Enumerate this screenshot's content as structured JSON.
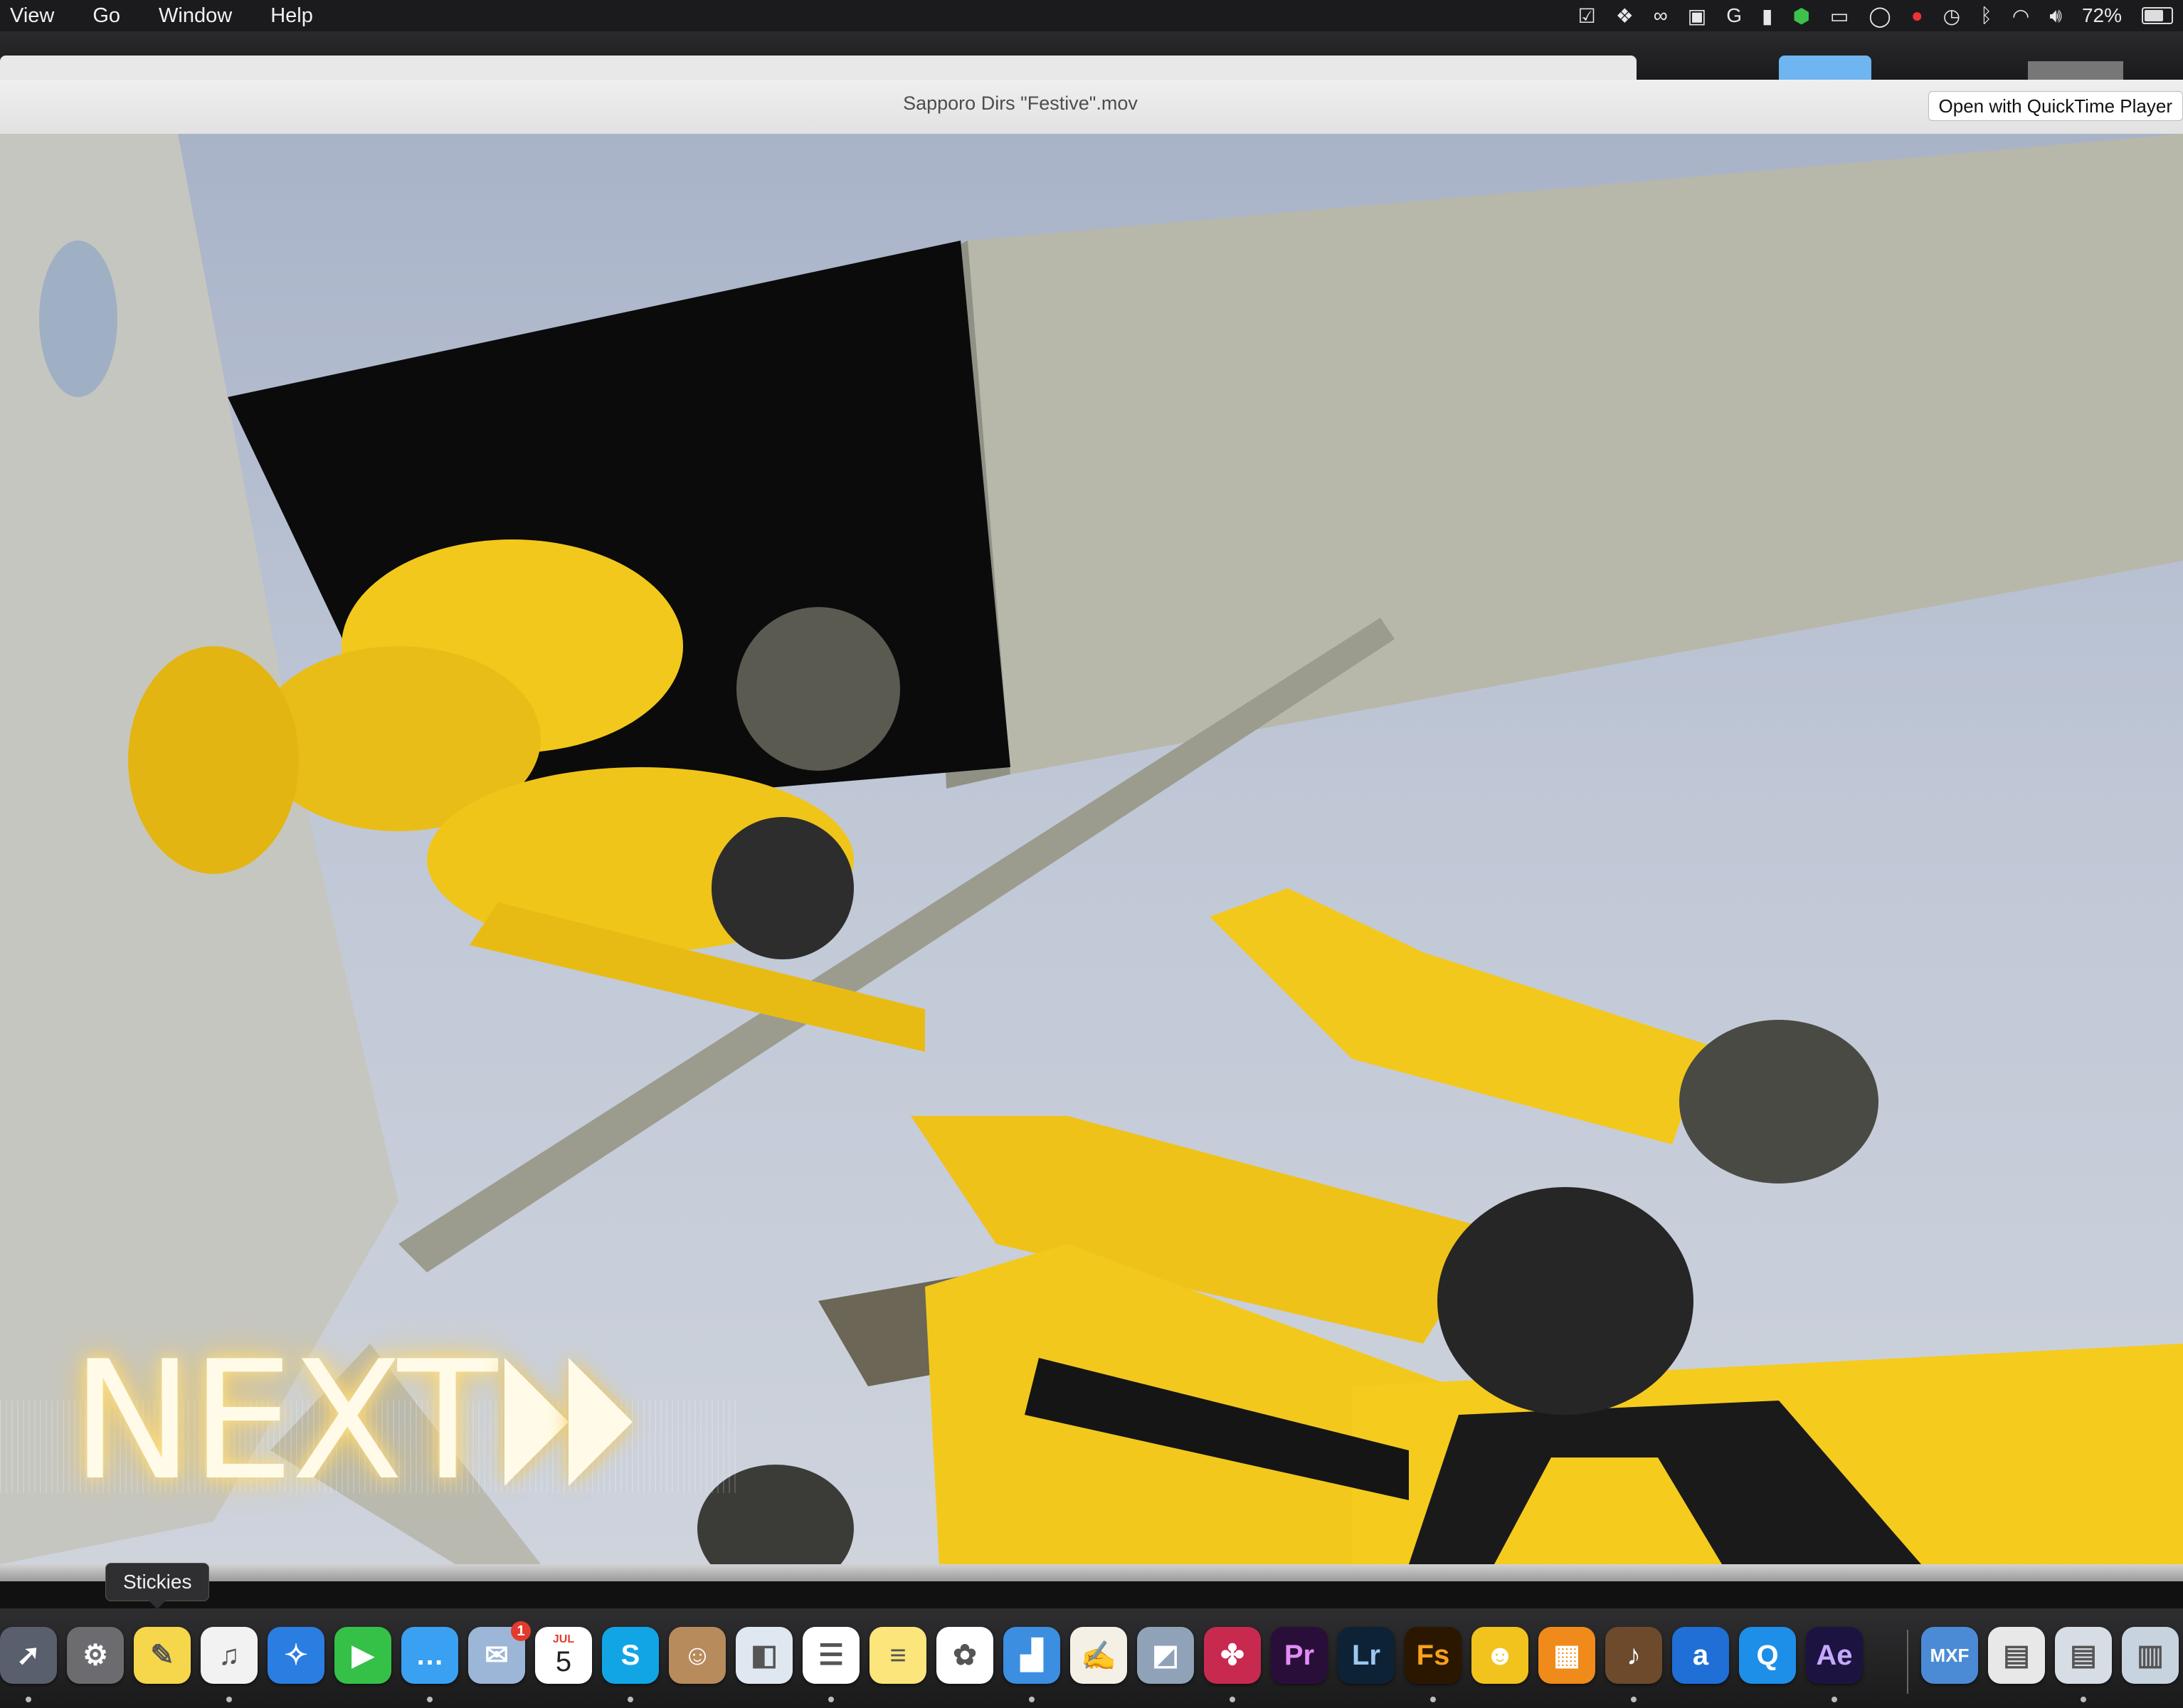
{
  "menubar": {
    "items": [
      "View",
      "Go",
      "Window",
      "Help"
    ],
    "battery_percent": "72%"
  },
  "quicklook": {
    "title": "Sapporo Dirs \"Festive\".mov",
    "open_with_label": "Open with QuickTime Player"
  },
  "video": {
    "overlay_text": "NEXT"
  },
  "tooltip": {
    "label": "Stickies"
  },
  "dock": {
    "items": [
      {
        "name": "launchpad",
        "icon": "rocket-icon",
        "color": "#5a5f6e"
      },
      {
        "name": "system-preferences",
        "icon": "gear-icon",
        "color": "#6c6c70"
      },
      {
        "name": "stickies",
        "icon": "stickies-icon",
        "color": "#f6d64a"
      },
      {
        "name": "itunes",
        "icon": "music-note-icon",
        "color": "#f2f2f2"
      },
      {
        "name": "safari",
        "icon": "compass-icon",
        "color": "#2a7de1"
      },
      {
        "name": "facetime",
        "icon": "video-camera-icon",
        "color": "#35c048"
      },
      {
        "name": "messages",
        "icon": "speech-bubble-icon",
        "color": "#3aa0f2"
      },
      {
        "name": "mail",
        "icon": "stamp-icon",
        "color": "#9cb6d8",
        "badge": "1"
      },
      {
        "name": "calendar",
        "icon": "calendar-icon",
        "color": "#ffffff",
        "month": "JUL",
        "day": "5"
      },
      {
        "name": "skype",
        "icon": "skype-icon",
        "color": "#12a5e6"
      },
      {
        "name": "contacts",
        "icon": "address-book-icon",
        "color": "#b88b5c"
      },
      {
        "name": "preview",
        "icon": "preview-icon",
        "color": "#dfe7f0"
      },
      {
        "name": "reminders",
        "icon": "checklist-icon",
        "color": "#ffffff"
      },
      {
        "name": "notes",
        "icon": "notepad-icon",
        "color": "#fce57a"
      },
      {
        "name": "photos",
        "icon": "pinwheel-icon",
        "color": "#ffffff"
      },
      {
        "name": "keynote",
        "icon": "podium-icon",
        "color": "#3b8ee0"
      },
      {
        "name": "textedit",
        "icon": "pen-paper-icon",
        "color": "#f4f0e6"
      },
      {
        "name": "image-capture",
        "icon": "camera-photos-icon",
        "color": "#8fa2b8"
      },
      {
        "name": "davinci-resolve",
        "icon": "resolve-icon",
        "color": "#c8294f"
      },
      {
        "name": "premiere-pro",
        "icon": "premiere-icon",
        "color": "#2a0e3a",
        "text": "Pr",
        "fg": "#e38cf5"
      },
      {
        "name": "lightroom",
        "icon": "lightroom-icon",
        "color": "#0e2236",
        "text": "Lr",
        "fg": "#9cc8ef"
      },
      {
        "name": "fuse",
        "icon": "fuse-icon",
        "color": "#2b1700",
        "text": "Fs",
        "fg": "#f7a21b"
      },
      {
        "name": "vlc-user",
        "icon": "avatar-icon",
        "color": "#f2c31c"
      },
      {
        "name": "claquette",
        "icon": "clapper-icon",
        "color": "#f08a1b"
      },
      {
        "name": "garageband",
        "icon": "guitar-icon",
        "color": "#6c4a2b"
      },
      {
        "name": "amazon",
        "icon": "amazon-icon",
        "color": "#1f6fd6",
        "text": "a",
        "fg": "#ffffff"
      },
      {
        "name": "quicktime",
        "icon": "quicktime-icon",
        "color": "#1d8fe8"
      },
      {
        "name": "after-effects",
        "icon": "after-effects-icon",
        "color": "#1c1340",
        "text": "Ae",
        "fg": "#c6a9ff"
      },
      {
        "name": "mxf-file",
        "icon": "mxf-icon",
        "color": "#4b8bd6",
        "text": "MXF",
        "fg": "#ffffff"
      },
      {
        "name": "document-file",
        "icon": "document-icon",
        "color": "#e8e8e8"
      },
      {
        "name": "screenshot-stack",
        "icon": "screenshot-icon",
        "color": "#d6dde5"
      },
      {
        "name": "downloads-stack",
        "icon": "stack-icon",
        "color": "#c7d3de"
      }
    ]
  }
}
